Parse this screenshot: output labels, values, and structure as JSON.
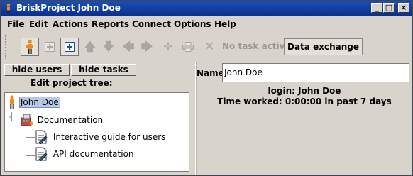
{
  "window": {
    "title": "BriskProject John Doe",
    "controls": {
      "minimize": "_",
      "maximize": "□",
      "close": "×"
    }
  },
  "menubar": {
    "items": [
      {
        "label": "File",
        "mnemonic": "F"
      },
      {
        "label": "Edit",
        "mnemonic": "E"
      },
      {
        "label": "Actions",
        "mnemonic": "A"
      },
      {
        "label": "Reports",
        "mnemonic": "R"
      },
      {
        "label": "Connect",
        "mnemonic": "C"
      },
      {
        "label": "Options",
        "mnemonic": "O"
      },
      {
        "label": "Help",
        "mnemonic": "H"
      }
    ]
  },
  "toolbar": {
    "icons": [
      "user-icon",
      "add-disabled-icon",
      "add-icon",
      "up-arrow-icon",
      "down-arrow-icon",
      "left-arrow-icon",
      "right-arrow-icon",
      "move-icon",
      "print-icon",
      "delete-icon"
    ],
    "status_label": "No task active",
    "data_exchange_label": "Data exchange"
  },
  "left_panel": {
    "hide_users_label": "hide users",
    "hide_tasks_label": "hide tasks",
    "tree_label": "Edit project tree:",
    "tree_label_mnemonic": "i",
    "tree": {
      "root": "John Doe",
      "folder": "Documentation",
      "docs": [
        "Interactive guide for users",
        "API documentation"
      ]
    }
  },
  "right_panel": {
    "name_label": "Name:",
    "name_value": "John Doe",
    "login_text": "login: John Doe",
    "time_text": "Time worked: 0:00:00 in past 7 days"
  }
}
